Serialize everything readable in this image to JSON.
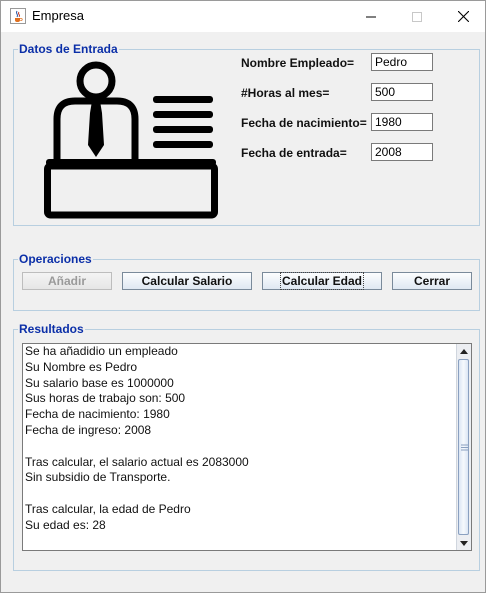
{
  "window": {
    "title": "Empresa",
    "icon": "java-cup-icon",
    "controls": {
      "minimize": "minimize-icon",
      "maximize": "maximize-icon",
      "close": "close-icon"
    }
  },
  "datos_entrada": {
    "legend": "Datos de Entrada",
    "illustration": "employee-desk-icon",
    "fields": [
      {
        "label": "Nombre Empleado=",
        "value": "Pedro"
      },
      {
        "label": "#Horas al mes=",
        "value": "500"
      },
      {
        "label": "Fecha de nacimiento=",
        "value": "1980"
      },
      {
        "label": "Fecha de entrada=",
        "value": "2008"
      }
    ]
  },
  "operaciones": {
    "legend": "Operaciones",
    "buttons": {
      "anadir": "Añadir",
      "calcular_salario": "Calcular Salario",
      "calcular_edad": "Calcular Edad",
      "cerrar": "Cerrar"
    }
  },
  "resultados": {
    "legend": "Resultados",
    "lines": [
      "Se ha añadidio un empleado",
      "Su Nombre es Pedro",
      "Su salario base es 1000000",
      "Sus horas de trabajo son: 500",
      "Fecha de nacimiento: 1980",
      "Fecha de ingreso: 2008",
      "",
      "Tras calcular, el salario actual es 2083000",
      "Sin subsidio de Transporte.",
      "",
      "Tras calcular, la edad de Pedro",
      "Su edad es: 28"
    ]
  },
  "colors": {
    "legend": "#0b2fa8",
    "group_border": "#b8cfe0",
    "background": "#f0f0f0"
  }
}
